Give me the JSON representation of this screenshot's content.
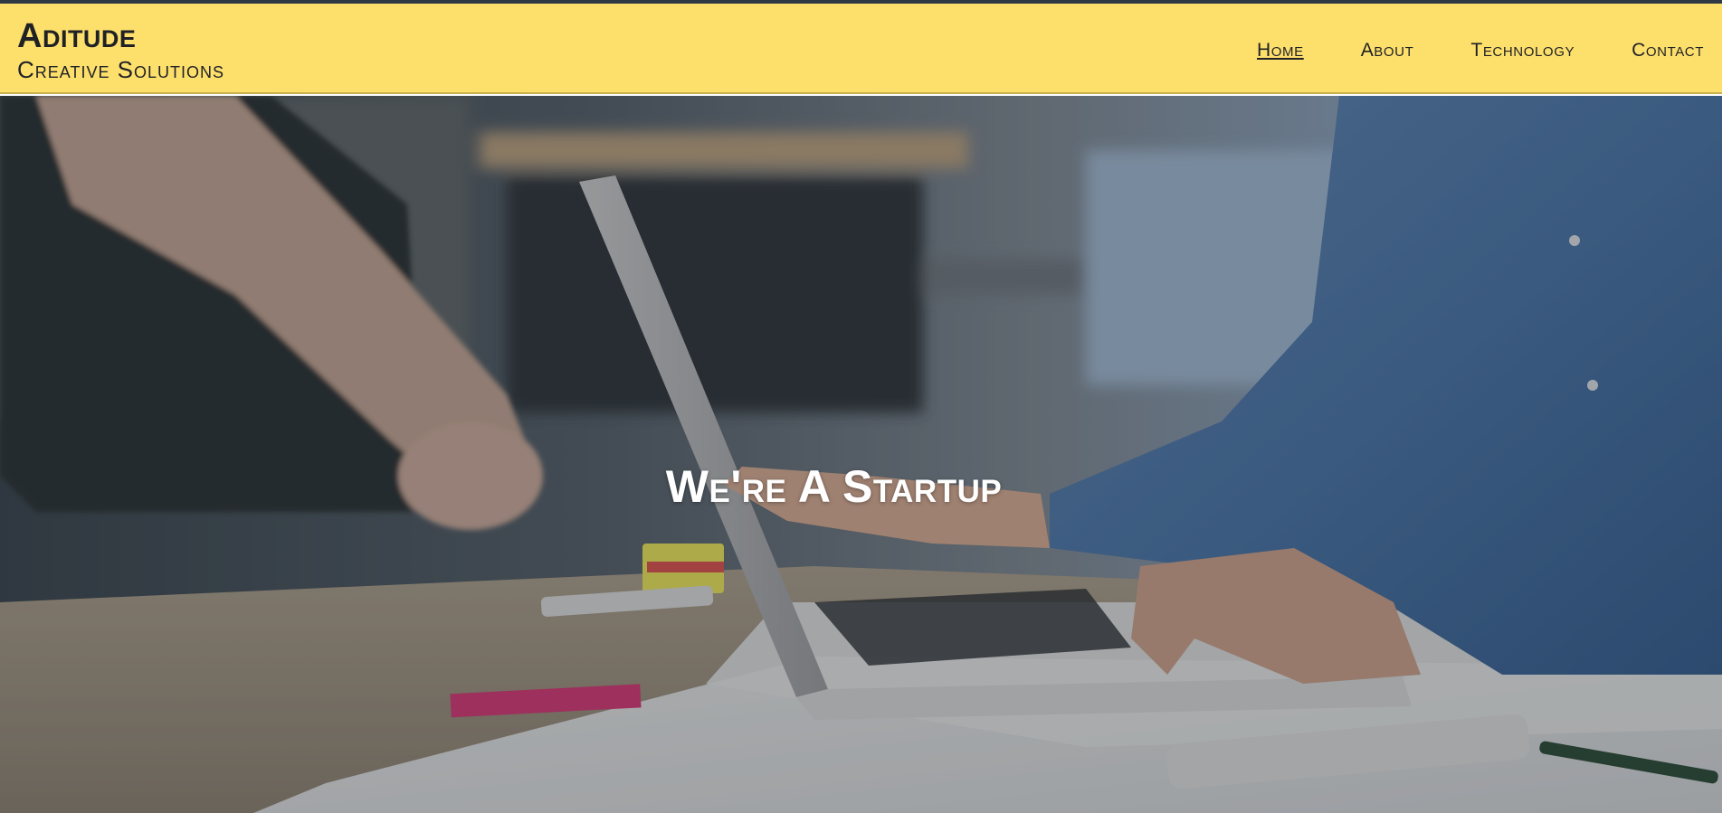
{
  "brand": {
    "name": "Aditude",
    "tagline": "Creative Solutions"
  },
  "nav": {
    "items": [
      {
        "label": "Home",
        "active": true
      },
      {
        "label": "About",
        "active": false
      },
      {
        "label": "Technology",
        "active": false
      },
      {
        "label": "Contact",
        "active": false
      }
    ]
  },
  "hero": {
    "title": "We're A Startup",
    "image_description_icon": "office-teamwork-photo"
  },
  "colors": {
    "header_bg": "#fddf6c",
    "top_strip": "#2f3a44",
    "text_dark": "#1f2125",
    "hero_text": "#ffffff"
  }
}
